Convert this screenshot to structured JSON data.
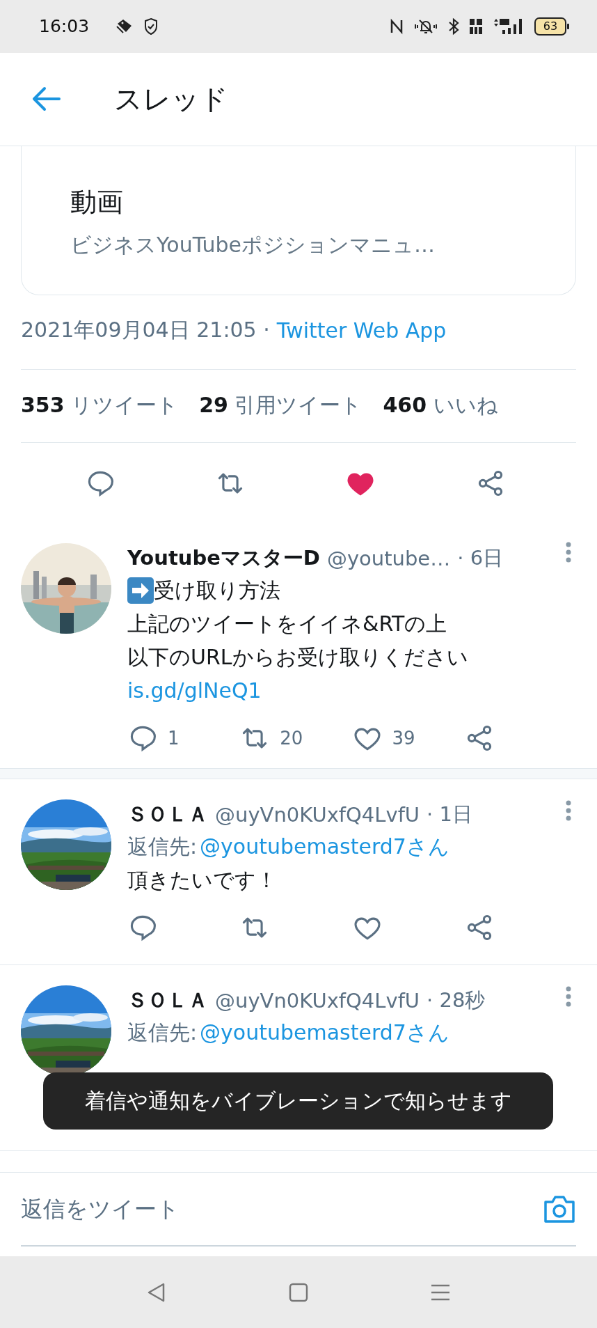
{
  "status_bar": {
    "time": "16:03",
    "battery": "63"
  },
  "header": {
    "title": "スレッド"
  },
  "link_card": {
    "title": "動画",
    "description": "ビジネスYouTubeポジションマニュ…"
  },
  "timestamp": {
    "date": "2021年09月04日 21:05 ·",
    "source": "Twitter Web App"
  },
  "stats": [
    {
      "count": "353",
      "label": "リツイート"
    },
    {
      "count": "29",
      "label": "引用ツイート"
    },
    {
      "count": "460",
      "label": "いいね"
    }
  ],
  "focused_actions": {
    "liked": true
  },
  "replies": [
    {
      "name": "YoutubeマスターD",
      "handle": "@youtube…",
      "time": "· 6日",
      "lines": [
        {
          "kind": "icon-text",
          "text": "受け取り方法"
        },
        {
          "kind": "text",
          "text": "上記のツイートをイイネ&RTの上"
        },
        {
          "kind": "text",
          "text": "以下のURLからお受け取りください"
        },
        {
          "kind": "link",
          "text": "is.gd/glNeQ1"
        }
      ],
      "reply_count": "1",
      "retweet_count": "20",
      "like_count": "39",
      "liked": false
    },
    {
      "name": "ＳＯＬＡ",
      "handle": "@uyVn0KUxfQ4LvfU",
      "time": "· 1日",
      "reply_to": {
        "label": "返信先:",
        "target": "@youtubemasterd7さん"
      },
      "lines": [
        {
          "kind": "text",
          "text": "頂きたいです！"
        }
      ],
      "liked": false
    },
    {
      "name": "ＳＯＬＡ",
      "handle": "@uyVn0KUxfQ4LvfU",
      "time": "· 28秒",
      "reply_to": {
        "label": "返信先:",
        "target": "@youtubemasterd7さん"
      }
    }
  ],
  "toast": {
    "message": "着信や通知をバイブレーションで知らせます"
  },
  "compose": {
    "placeholder": "返信をツイート"
  }
}
